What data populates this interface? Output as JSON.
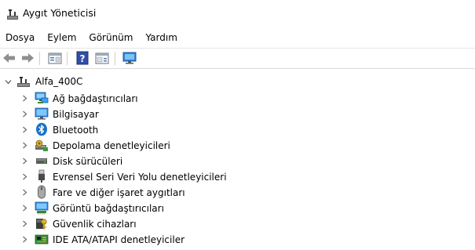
{
  "window": {
    "title": "Aygıt Yöneticisi"
  },
  "menu": {
    "items": [
      "Dosya",
      "Eylem",
      "Görünüm",
      "Yardım"
    ]
  },
  "toolbar": {
    "buttons": [
      "back-arrow-icon",
      "forward-arrow-icon",
      "properties-icon",
      "help-icon",
      "update-driver-icon",
      "monitor-icon"
    ]
  },
  "tree": {
    "root": {
      "label": "Alfa_400C",
      "icon": "computer-icon",
      "expanded": true
    },
    "items": [
      {
        "label": "Ağ bağdaştırıcıları",
        "icon": "network-adapter-icon"
      },
      {
        "label": "Bilgisayar",
        "icon": "computer-monitor-icon"
      },
      {
        "label": "Bluetooth",
        "icon": "bluetooth-icon"
      },
      {
        "label": "Depolama denetleyicileri",
        "icon": "storage-controller-icon"
      },
      {
        "label": "Disk sürücüleri",
        "icon": "disk-drive-icon"
      },
      {
        "label": "Evrensel Seri Veri Yolu denetleyicileri",
        "icon": "usb-icon"
      },
      {
        "label": "Fare ve diğer işaret aygıtları",
        "icon": "mouse-icon"
      },
      {
        "label": "Görüntü bağdaştırıcıları",
        "icon": "display-adapter-icon"
      },
      {
        "label": "Güvenlik cihazları",
        "icon": "security-device-icon"
      },
      {
        "label": "IDE ATA/ATAPI denetleyiciler",
        "icon": "ide-controller-icon"
      }
    ]
  },
  "colors": {
    "window_bg": "#ffffff",
    "toolbar_border": "#d9d9d9",
    "expander": "#6b6b6b",
    "accent_blue": "#1a73c9"
  }
}
